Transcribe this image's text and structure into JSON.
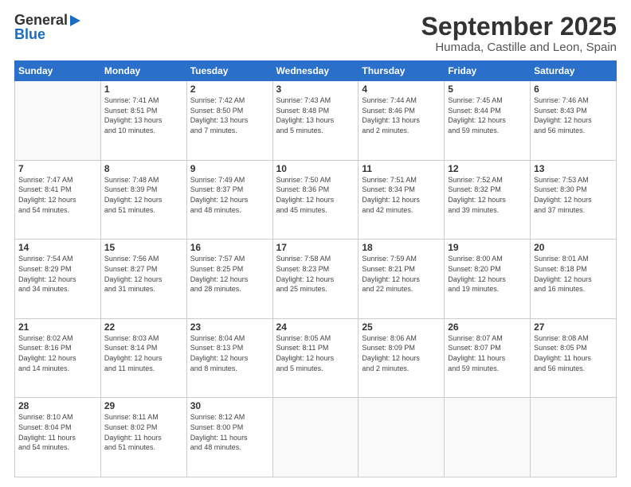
{
  "header": {
    "logo_general": "General",
    "logo_blue": "Blue",
    "month": "September 2025",
    "location": "Humada, Castille and Leon, Spain"
  },
  "days_of_week": [
    "Sunday",
    "Monday",
    "Tuesday",
    "Wednesday",
    "Thursday",
    "Friday",
    "Saturday"
  ],
  "weeks": [
    [
      {
        "day": "",
        "info": ""
      },
      {
        "day": "1",
        "info": "Sunrise: 7:41 AM\nSunset: 8:51 PM\nDaylight: 13 hours\nand 10 minutes."
      },
      {
        "day": "2",
        "info": "Sunrise: 7:42 AM\nSunset: 8:50 PM\nDaylight: 13 hours\nand 7 minutes."
      },
      {
        "day": "3",
        "info": "Sunrise: 7:43 AM\nSunset: 8:48 PM\nDaylight: 13 hours\nand 5 minutes."
      },
      {
        "day": "4",
        "info": "Sunrise: 7:44 AM\nSunset: 8:46 PM\nDaylight: 13 hours\nand 2 minutes."
      },
      {
        "day": "5",
        "info": "Sunrise: 7:45 AM\nSunset: 8:44 PM\nDaylight: 12 hours\nand 59 minutes."
      },
      {
        "day": "6",
        "info": "Sunrise: 7:46 AM\nSunset: 8:43 PM\nDaylight: 12 hours\nand 56 minutes."
      }
    ],
    [
      {
        "day": "7",
        "info": "Sunrise: 7:47 AM\nSunset: 8:41 PM\nDaylight: 12 hours\nand 54 minutes."
      },
      {
        "day": "8",
        "info": "Sunrise: 7:48 AM\nSunset: 8:39 PM\nDaylight: 12 hours\nand 51 minutes."
      },
      {
        "day": "9",
        "info": "Sunrise: 7:49 AM\nSunset: 8:37 PM\nDaylight: 12 hours\nand 48 minutes."
      },
      {
        "day": "10",
        "info": "Sunrise: 7:50 AM\nSunset: 8:36 PM\nDaylight: 12 hours\nand 45 minutes."
      },
      {
        "day": "11",
        "info": "Sunrise: 7:51 AM\nSunset: 8:34 PM\nDaylight: 12 hours\nand 42 minutes."
      },
      {
        "day": "12",
        "info": "Sunrise: 7:52 AM\nSunset: 8:32 PM\nDaylight: 12 hours\nand 39 minutes."
      },
      {
        "day": "13",
        "info": "Sunrise: 7:53 AM\nSunset: 8:30 PM\nDaylight: 12 hours\nand 37 minutes."
      }
    ],
    [
      {
        "day": "14",
        "info": "Sunrise: 7:54 AM\nSunset: 8:29 PM\nDaylight: 12 hours\nand 34 minutes."
      },
      {
        "day": "15",
        "info": "Sunrise: 7:56 AM\nSunset: 8:27 PM\nDaylight: 12 hours\nand 31 minutes."
      },
      {
        "day": "16",
        "info": "Sunrise: 7:57 AM\nSunset: 8:25 PM\nDaylight: 12 hours\nand 28 minutes."
      },
      {
        "day": "17",
        "info": "Sunrise: 7:58 AM\nSunset: 8:23 PM\nDaylight: 12 hours\nand 25 minutes."
      },
      {
        "day": "18",
        "info": "Sunrise: 7:59 AM\nSunset: 8:21 PM\nDaylight: 12 hours\nand 22 minutes."
      },
      {
        "day": "19",
        "info": "Sunrise: 8:00 AM\nSunset: 8:20 PM\nDaylight: 12 hours\nand 19 minutes."
      },
      {
        "day": "20",
        "info": "Sunrise: 8:01 AM\nSunset: 8:18 PM\nDaylight: 12 hours\nand 16 minutes."
      }
    ],
    [
      {
        "day": "21",
        "info": "Sunrise: 8:02 AM\nSunset: 8:16 PM\nDaylight: 12 hours\nand 14 minutes."
      },
      {
        "day": "22",
        "info": "Sunrise: 8:03 AM\nSunset: 8:14 PM\nDaylight: 12 hours\nand 11 minutes."
      },
      {
        "day": "23",
        "info": "Sunrise: 8:04 AM\nSunset: 8:13 PM\nDaylight: 12 hours\nand 8 minutes."
      },
      {
        "day": "24",
        "info": "Sunrise: 8:05 AM\nSunset: 8:11 PM\nDaylight: 12 hours\nand 5 minutes."
      },
      {
        "day": "25",
        "info": "Sunrise: 8:06 AM\nSunset: 8:09 PM\nDaylight: 12 hours\nand 2 minutes."
      },
      {
        "day": "26",
        "info": "Sunrise: 8:07 AM\nSunset: 8:07 PM\nDaylight: 11 hours\nand 59 minutes."
      },
      {
        "day": "27",
        "info": "Sunrise: 8:08 AM\nSunset: 8:05 PM\nDaylight: 11 hours\nand 56 minutes."
      }
    ],
    [
      {
        "day": "28",
        "info": "Sunrise: 8:10 AM\nSunset: 8:04 PM\nDaylight: 11 hours\nand 54 minutes."
      },
      {
        "day": "29",
        "info": "Sunrise: 8:11 AM\nSunset: 8:02 PM\nDaylight: 11 hours\nand 51 minutes."
      },
      {
        "day": "30",
        "info": "Sunrise: 8:12 AM\nSunset: 8:00 PM\nDaylight: 11 hours\nand 48 minutes."
      },
      {
        "day": "",
        "info": ""
      },
      {
        "day": "",
        "info": ""
      },
      {
        "day": "",
        "info": ""
      },
      {
        "day": "",
        "info": ""
      }
    ]
  ]
}
